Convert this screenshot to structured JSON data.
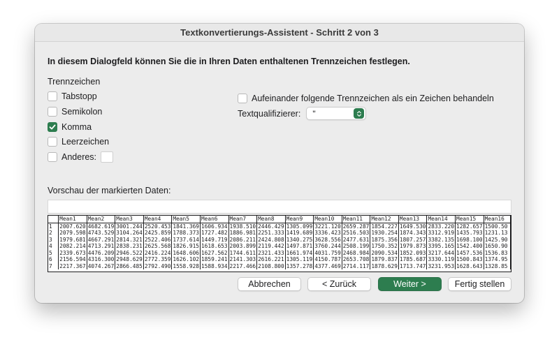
{
  "window": {
    "title": "Textkonvertierungs-Assistent - Schritt 2 von 3"
  },
  "heading": "In diesem Dialogfeld können Sie die in Ihren Daten enthaltenen Trennzeichen festlegen.",
  "delimiters": {
    "label": "Trennzeichen",
    "items": [
      {
        "label": "Tabstopp",
        "checked": false
      },
      {
        "label": "Semikolon",
        "checked": false
      },
      {
        "label": "Komma",
        "checked": true
      },
      {
        "label": "Leerzeichen",
        "checked": false
      },
      {
        "label": "Anderes:",
        "checked": false
      }
    ]
  },
  "options": {
    "consecutive_label": "Aufeinander folgende Trennzeichen als ein Zeichen behandeln",
    "consecutive_checked": false,
    "qualifier_label": "Textqualifizierer:",
    "qualifier_value": "\""
  },
  "preview": {
    "label": "Vorschau der markierten Daten:",
    "headers": [
      "",
      "Mean1",
      "Mean2",
      "Mean3",
      "Mean4",
      "Mean5",
      "Mean6",
      "Mean7",
      "Mean8",
      "Mean9",
      "Mean10",
      "Mean11",
      "Mean12",
      "Mean13",
      "Mean14",
      "Mean15",
      "Mean16"
    ],
    "rows": [
      [
        "1",
        "2007.620",
        "4682.619",
        "3001.244",
        "2520.453",
        "1841.369",
        "1606.934",
        "1938.510",
        "2446.429",
        "1305.099",
        "3221.120",
        "2659.287",
        "1854.227",
        "1649.530",
        "2833.220",
        "1282.657",
        "1500.50"
      ],
      [
        "2",
        "2079.598",
        "4743.529",
        "3104.264",
        "2425.859",
        "1788.373",
        "1727.482",
        "1886.981",
        "2251.333",
        "1419.689",
        "3336.423",
        "2516.503",
        "1930.254",
        "1874.343",
        "3312.919",
        "1435.793",
        "1231.13"
      ],
      [
        "3",
        "1979.681",
        "4667.291",
        "2814.321",
        "2522.406",
        "1737.614",
        "1449.719",
        "2086.211",
        "2424.808",
        "1340.275",
        "3628.556",
        "2477.631",
        "1875.356",
        "1807.257",
        "3382.135",
        "1698.100",
        "1425.90"
      ],
      [
        "4",
        "2082.214",
        "4713.291",
        "2838.231",
        "2625.568",
        "1826.915",
        "1618.653",
        "2003.899",
        "2119.442",
        "1497.871",
        "3760.244",
        "2508.199",
        "1750.352",
        "1979.873",
        "3395.165",
        "1542.400",
        "1650.90"
      ],
      [
        "5",
        "2339.673",
        "4476.209",
        "2946.522",
        "2416.224",
        "1648.606",
        "1627.562",
        "1744.611",
        "2321.433",
        "1661.974",
        "4031.759",
        "2468.984",
        "2090.534",
        "1852.093",
        "3217.644",
        "1457.536",
        "1536.83"
      ],
      [
        "6",
        "2156.594",
        "4316.300",
        "2948.629",
        "2772.359",
        "1626.102",
        "1859.241",
        "2141.303",
        "2616.221",
        "1305.119",
        "4150.787",
        "2653.708",
        "1879.837",
        "1785.687",
        "3330.119",
        "1500.843",
        "1374.95"
      ],
      [
        "7",
        "2217.367",
        "4074.267",
        "2866.485",
        "2792.490",
        "1558.928",
        "1588.934",
        "2217.466",
        "2108.800",
        "1357.278",
        "4377.469",
        "2714.117",
        "1878.629",
        "1713.747",
        "3231.953",
        "1628.643",
        "1328.85"
      ]
    ]
  },
  "buttons": {
    "cancel": "Abbrechen",
    "back": "< Zurück",
    "next": "Weiter >",
    "finish": "Fertig stellen"
  },
  "colors": {
    "accent": "#2d7d4f",
    "dialog_bg": "#ececec"
  }
}
